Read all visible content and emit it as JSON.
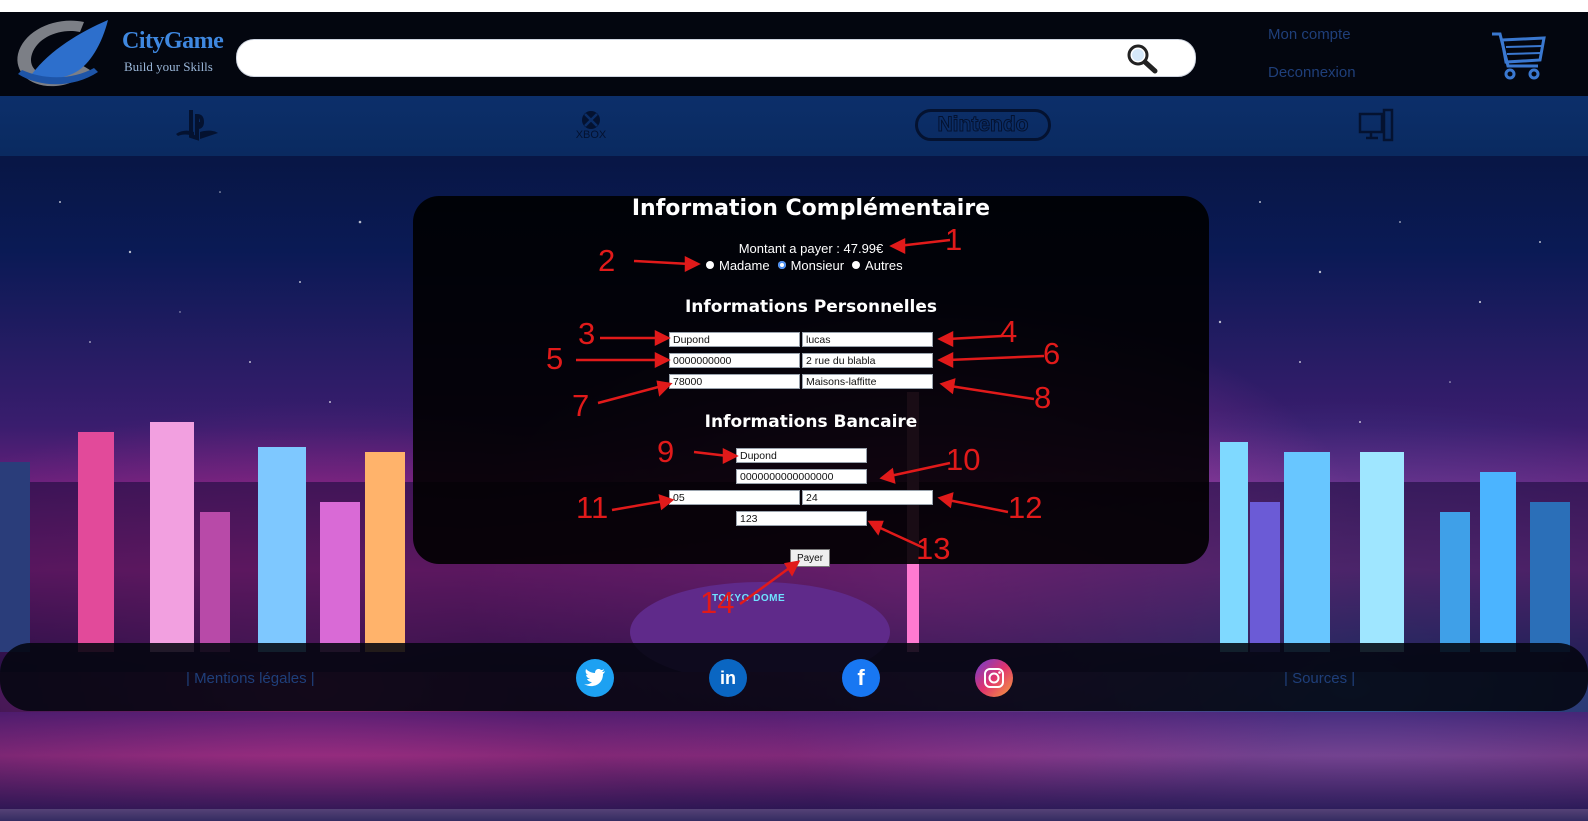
{
  "header": {
    "brand_name": "CityGame",
    "brand_tagline": "Build your Skills",
    "search": {
      "value": "",
      "placeholder": ""
    },
    "account_links": [
      "Mon compte",
      "Deconnexion"
    ]
  },
  "nav": {
    "platforms": [
      {
        "icon": "playstation-icon"
      },
      {
        "icon": "xbox-icon",
        "label": "XBOX"
      },
      {
        "icon": "nintendo-icon",
        "label": "Nintendo"
      },
      {
        "icon": "pc-icon"
      }
    ]
  },
  "form": {
    "title": "Information Complémentaire",
    "amount_text": "Montant a payer : 47.99€",
    "civility": {
      "options": [
        "Madame",
        "Monsieur",
        "Autres"
      ],
      "selected": "Monsieur"
    },
    "personal_title": "Informations Personnelles",
    "personal": {
      "last_name": "Dupond",
      "first_name": "lucas",
      "phone": "0000000000",
      "address": "2 rue du blabla",
      "postal_code": "78000",
      "city": "Maisons-laffitte"
    },
    "bank_title": "Informations Bancaire",
    "bank": {
      "card_holder": "Dupond",
      "card_number": "0000000000000000",
      "exp_month": "05",
      "exp_year": "24",
      "cvv": "123"
    },
    "pay_label": "Payer"
  },
  "annotations": [
    "1",
    "2",
    "3",
    "4",
    "5",
    "6",
    "7",
    "8",
    "9",
    "10",
    "11",
    "12",
    "13",
    "14"
  ],
  "scene": {
    "dome_label": "TOKYO DOME"
  },
  "footer": {
    "mentions": "| Mentions légales |",
    "sources": "| Sources |",
    "social": [
      "twitter-icon",
      "linkedin-icon",
      "facebook-icon",
      "instagram-icon"
    ]
  },
  "colors": {
    "accent": "#3f88e0",
    "annotation": "#e11a1a",
    "panel": "#000000"
  }
}
